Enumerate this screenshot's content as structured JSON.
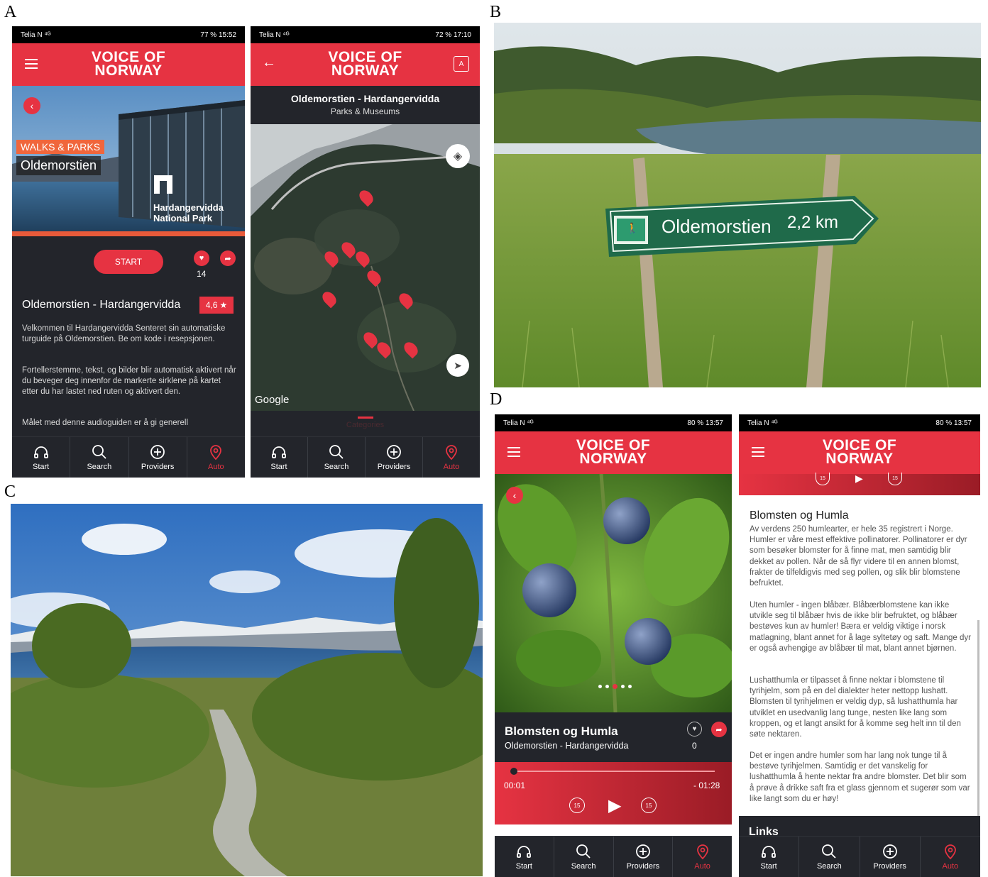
{
  "labels": {
    "a": "A",
    "b": "B",
    "c": "C",
    "d": "D"
  },
  "colors": {
    "accent": "#e63342",
    "dark": "#23252b"
  },
  "logo": "VOICE OF\nNORWAY",
  "nav": [
    "Start",
    "Search",
    "Providers",
    "Auto"
  ],
  "phone1": {
    "status_left": "Telia N ⁴ᴳ",
    "status_right": "77 % 15:52",
    "category": "WALKS & PARKS",
    "title_tag": "Oldemorstien",
    "park_name": "Hardangervidda\nNational Park",
    "start_label": "START",
    "like_count": "14",
    "tour_title": "Oldemorstien - Hardangervidda",
    "rating": "4,6",
    "desc1": "Velkommen til Hardangervidda Senteret sin automatiske turguide på Oldemorstien. Be om kode i resepsjonen.",
    "desc2": "Fortellerstemme, tekst, og bilder blir automatisk aktivert når du beveger deg innenfor de markerte sirklene på kartet etter du har lastet ned ruten og aktivert den.",
    "desc3": "Målet med denne audioguiden er å gi generell"
  },
  "phone2": {
    "status_left": "Telia N ⁴ᴳ",
    "status_right": "72 % 17:10",
    "title": "Oldemorstien - Hardangervidda",
    "subtitle": "Parks & Museums",
    "map_attribution": "Google",
    "tab_label": "Categories"
  },
  "photo_b": {
    "sign_text": "Oldemorstien",
    "sign_distance": "2,2  km"
  },
  "phone3": {
    "status_left": "Telia N ⁴ᴳ",
    "status_right": "80 % 13:57",
    "track_title": "Blomsten og Humla",
    "track_subtitle": "Oldemorstien - Hardangervidda",
    "like_count": "0",
    "time_elapsed": "00:01",
    "time_remaining": "- 01:28",
    "skip_seconds": "15"
  },
  "phone4": {
    "status_left": "Telia N ⁴ᴳ",
    "status_right": "80 % 13:57",
    "heading": "Blomsten og Humla",
    "p1": "Av verdens 250 humlearter, er hele 35 registrert i Norge. Humler er våre mest effektive pollinatorer. Pollinatorer er dyr som besøker blomster for å finne mat, men samtidig blir dekket av pollen. Når de så flyr videre til en annen blomst, frakter de tilfeldigvis med seg pollen, og slik blir blomstene befruktet.",
    "p2": "Uten humler - ingen blåbær. Blåbærblomstene kan ikke utvikle seg til blåbær hvis de ikke blir befruktet, og blåbær bestøves kun av humler! Bæra er veldig viktige i norsk matlagning, blant annet for å lage syltetøy og saft. Mange dyr er også avhengige av blåbær til mat, blant annet bjørnen.",
    "p3": "Lushatthumla er tilpasset å finne nektar i blomstene til tyrihjelm, som på en del dialekter heter nettopp lushatt. Blomsten til tyrihjelmen er veldig dyp, så lushatthumla har utviklet en usedvanlig lang tunge, nesten like lang som kroppen, og et langt ansikt for å komme seg helt inn til den søte nektaren.",
    "p4": "Det er ingen andre humler som har lang nok tunge til å bestøve tyrihjelmen. Samtidig er det vanskelig for lushatthumla å hente nektar fra andre blomster. Det blir som å prøve å drikke saft fra et glass gjennom et sugerør som var like langt som du er høy!",
    "links_label": "Links",
    "skip_seconds": "15"
  }
}
